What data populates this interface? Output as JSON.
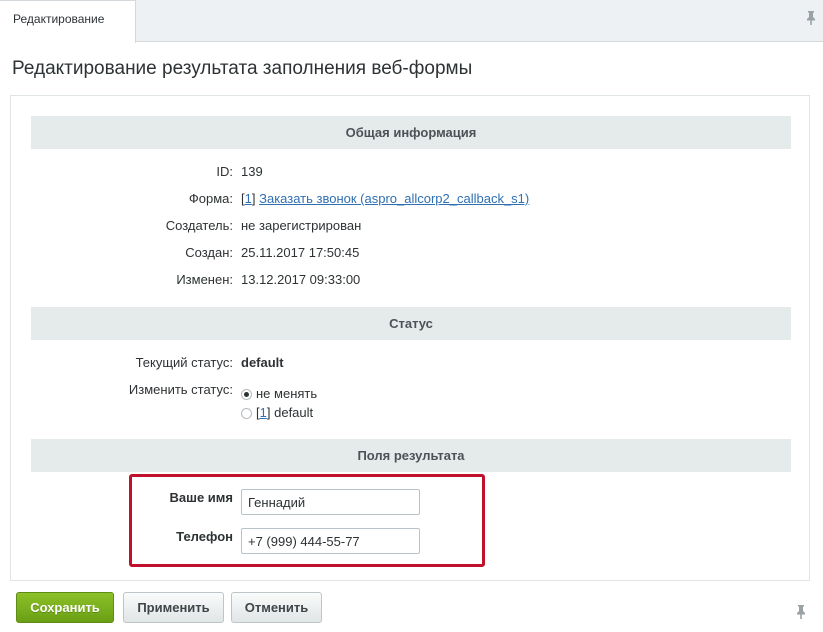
{
  "tab": {
    "label": "Редактирование"
  },
  "page": {
    "title": "Редактирование результата заполнения веб-формы"
  },
  "sections": {
    "general": "Общая информация",
    "status": "Статус",
    "fields": "Поля результата"
  },
  "info": {
    "id_label": "ID:",
    "id_value": "139",
    "form_label": "Форма:",
    "form_bracket_open": "[",
    "form_id": "1",
    "form_bracket_close": "]",
    "form_link": "Заказать звонок (aspro_allcorp2_callback_s1)",
    "creator_label": "Создатель:",
    "creator_value": "не зарегистрирован",
    "created_label": "Создан:",
    "created_value": "25.11.2017 17:50:45",
    "changed_label": "Изменен:",
    "changed_value": "13.12.2017 09:33:00"
  },
  "status": {
    "current_label": "Текущий статус:",
    "current_value": "default",
    "change_label": "Изменить статус:",
    "options": [
      {
        "label": "не менять",
        "checked": true
      },
      {
        "bracket_open": "[",
        "id": "1",
        "bracket_close": "]",
        "label": "default",
        "checked": false
      }
    ]
  },
  "result_fields": {
    "name_label": "Ваше имя",
    "name_value": "Геннадий",
    "phone_label": "Телефон",
    "phone_value": "+7 (999) 444-55-77"
  },
  "buttons": {
    "save": "Сохранить",
    "apply": "Применить",
    "cancel": "Отменить"
  },
  "colors": {
    "accent_green": "#7bb01e",
    "highlight_red": "#c0102a",
    "link_blue": "#2f6fb2"
  }
}
